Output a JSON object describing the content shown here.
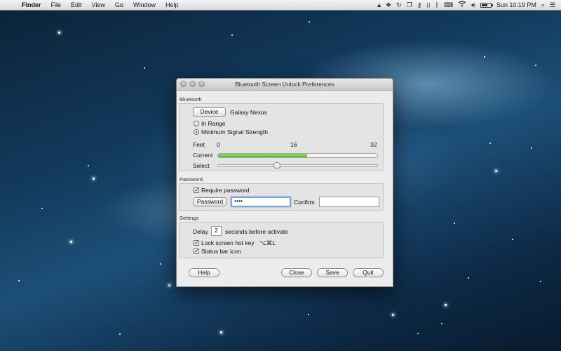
{
  "menubar": {
    "apple_glyph": "",
    "app_name": "Finder",
    "menus": [
      "File",
      "Edit",
      "View",
      "Go",
      "Window",
      "Help"
    ],
    "clock": "Sun 10:19 PM",
    "battery_level": 0.7
  },
  "window": {
    "title": "Bluetooth Screen Unlock Preferences"
  },
  "bluetooth": {
    "section_label": "Bluetooth",
    "device_button": "Device",
    "device_name": "Galaxy Nexus",
    "option_in_range": "In Range",
    "option_min_signal": "Minimum Signal Strength",
    "selected_option": "Minimum Signal Strength",
    "feet_label": "Feet",
    "scale": [
      "0",
      "16",
      "32"
    ],
    "current_label": "Current",
    "current_fraction": 0.56,
    "select_label": "Select",
    "select_fraction": 0.36
  },
  "password": {
    "section_label": "Password",
    "require_label": "Require password",
    "require_checked": true,
    "password_button": "Password",
    "password_value": "••••",
    "confirm_label": "Confirm",
    "confirm_value": ""
  },
  "settings": {
    "section_label": "Settings",
    "delay_label": "Delay",
    "delay_value": "2",
    "delay_suffix": "seconds before activate",
    "hotkey_label": "Lock screen hot key",
    "hotkey_checked": true,
    "hotkey_value": "⌥⌘L",
    "statusbar_label": "Status bar icon",
    "statusbar_checked": true
  },
  "buttons": {
    "help": "Help",
    "close": "Close",
    "save": "Save",
    "quit": "Quit"
  }
}
